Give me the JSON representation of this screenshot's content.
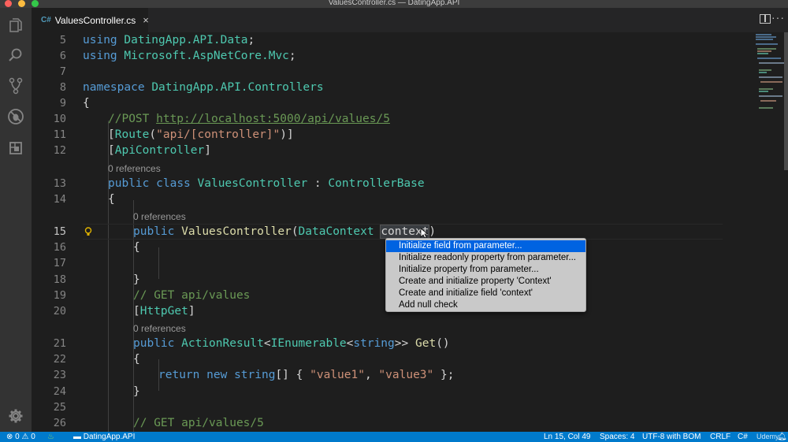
{
  "window": {
    "title": "ValuesController.cs — DatingApp.API"
  },
  "activity_bar": [
    "files-icon",
    "search-icon",
    "source-control-icon",
    "debug-icon",
    "extensions-icon",
    "settings-gear-icon"
  ],
  "tabs": [
    {
      "icon": "C#",
      "label": "ValuesController.cs",
      "close": "×"
    }
  ],
  "editor": {
    "current_line": 15,
    "codelens": {
      "l13": "0 references",
      "l15": "0 references",
      "l21": "0 references"
    },
    "lines": {
      "l5": [
        "using",
        " ",
        "DatingApp.API.Data",
        ";"
      ],
      "l6": [
        "using",
        " ",
        "Microsoft.AspNetCore.Mvc",
        ";"
      ],
      "l8": [
        "namespace",
        " ",
        "DatingApp.API.Controllers"
      ],
      "l9": "{",
      "l10": [
        "//POST ",
        "http://localhost:5000/api/values/5"
      ],
      "l11": [
        "[",
        "Route",
        "(",
        "\"api/[controller]\"",
        ")]"
      ],
      "l12": [
        "[",
        "ApiController",
        "]"
      ],
      "l13": [
        "public",
        " ",
        "class",
        " ",
        "ValuesController",
        " : ",
        "ControllerBase"
      ],
      "l14": "{",
      "l15": [
        "public",
        " ",
        "ValuesController",
        "(",
        "DataContext",
        " ",
        "context",
        ")"
      ],
      "l16": "{",
      "l18": "}",
      "l19": "// GET api/values",
      "l20": [
        "[",
        "HttpGet",
        "]"
      ],
      "l21": [
        "public",
        " ",
        "ActionResult",
        "<",
        "IEnumerable",
        "<",
        "string",
        ">> ",
        "Get",
        "()"
      ],
      "l22": "{",
      "l23": [
        "return",
        " ",
        "new",
        " ",
        "string",
        "[] { ",
        "\"value1\"",
        ", ",
        "\"value3\"",
        " };"
      ],
      "l24": "}",
      "l26": "// GET api/values/5"
    }
  },
  "quick_fix": {
    "items": [
      "Initialize field from parameter...",
      "Initialize readonly property from parameter...",
      "Initialize property from parameter...",
      "Create and initialize property 'Context'",
      "Create and initialize field 'context'",
      "Add null check"
    ],
    "selected_index": 0
  },
  "status_bar": {
    "errors": "0",
    "warnings": "0",
    "project": "DatingApp.API",
    "position": "Ln 15, Col 49",
    "spaces": "Spaces: 4",
    "encoding": "UTF-8 with BOM",
    "eol": "CRLF",
    "language": "C#",
    "watermark": "Udemy"
  },
  "colors": {
    "accent": "#007acc",
    "selection": "#0063e1",
    "keyword": "#569cd6",
    "type": "#4ec9b0",
    "string": "#ce9178",
    "comment": "#6a9955"
  }
}
